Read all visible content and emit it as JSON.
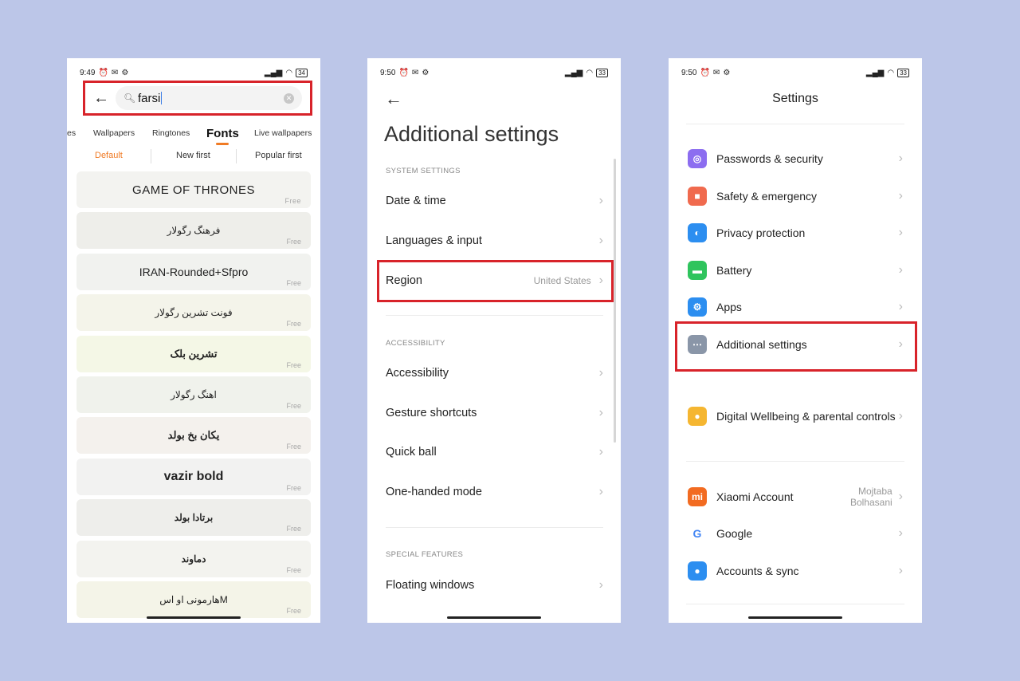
{
  "colors": {
    "background": "#bcc6e8",
    "highlight": "#d8232a",
    "accent": "#f07b25"
  },
  "phone1": {
    "status": {
      "time": "9:49",
      "battery": "34"
    },
    "search": {
      "query": "farsi"
    },
    "tabs": [
      "es",
      "Wallpapers",
      "Ringtones",
      "Fonts",
      "Live wallpapers"
    ],
    "active_tab": "Fonts",
    "sort": [
      "Default",
      "New first",
      "Popular first"
    ],
    "fonts": [
      {
        "name": "GAME OF THRONES",
        "price": "Free",
        "bg": "#f3f3f0"
      },
      {
        "name": "فرهنگ رگولار",
        "price": "Free",
        "bg": "#eeeeea"
      },
      {
        "name": "IRAN-Rounded+Sfpro",
        "price": "Free",
        "bg": "#f1f2ef"
      },
      {
        "name": "فونت تشرین رگولار",
        "price": "Free",
        "bg": "#f4f4ea"
      },
      {
        "name": "تشرین بلک",
        "price": "Free",
        "bg": "#f4f7e6"
      },
      {
        "name": "اهنگ رگولار",
        "price": "Free",
        "bg": "#f0f2ec"
      },
      {
        "name": "یکان بخ بولد",
        "price": "Free",
        "bg": "#f4f1ed"
      },
      {
        "name": "vazir bold",
        "price": "Free",
        "bg": "#f2f2f1"
      },
      {
        "name": "برتادا بولد",
        "price": "Free",
        "bg": "#eeeeeb"
      },
      {
        "name": "دماوند",
        "price": "Free",
        "bg": "#f3f3ef"
      },
      {
        "name": "هارمونی او اسM",
        "price": "Free",
        "bg": "#f4f4e8"
      }
    ]
  },
  "phone2": {
    "status": {
      "time": "9:50",
      "battery": "33"
    },
    "title": "Additional settings",
    "sections": {
      "system": "SYSTEM SETTINGS",
      "accessibility": "ACCESSIBILITY",
      "special": "SPECIAL FEATURES"
    },
    "rows": {
      "date_time": "Date & time",
      "languages": "Languages & input",
      "region": "Region",
      "region_value": "United States",
      "accessibility": "Accessibility",
      "gesture": "Gesture shortcuts",
      "quick_ball": "Quick ball",
      "one_handed": "One-handed mode",
      "floating": "Floating windows"
    }
  },
  "phone3": {
    "status": {
      "time": "9:50",
      "battery": "33"
    },
    "title": "Settings",
    "items": [
      {
        "label": "Passwords & security",
        "icon": "fingerprint-icon",
        "color": "#8c6df0"
      },
      {
        "label": "Safety & emergency",
        "icon": "emergency-icon",
        "color": "#f06a4e"
      },
      {
        "label": "Privacy protection",
        "icon": "privacy-icon",
        "color": "#2c8ef0"
      },
      {
        "label": "Battery",
        "icon": "battery-icon",
        "color": "#2fc45d"
      },
      {
        "label": "Apps",
        "icon": "gear-icon",
        "color": "#2c8ef0"
      },
      {
        "label": "Additional settings",
        "icon": "more-icon",
        "color": "#8a96a8"
      },
      {
        "label": "Digital Wellbeing & parental controls",
        "icon": "wellbeing-icon",
        "color": "#f5b631"
      },
      {
        "label": "Xiaomi Account",
        "icon": "mi-icon",
        "color": "#f26b21",
        "value_1": "Mojtaba",
        "value_2": "Bolhasani"
      },
      {
        "label": "Google",
        "icon": "google-icon",
        "color": "#ffffff"
      },
      {
        "label": "Accounts & sync",
        "icon": "person-icon",
        "color": "#2c8ef0"
      }
    ]
  }
}
